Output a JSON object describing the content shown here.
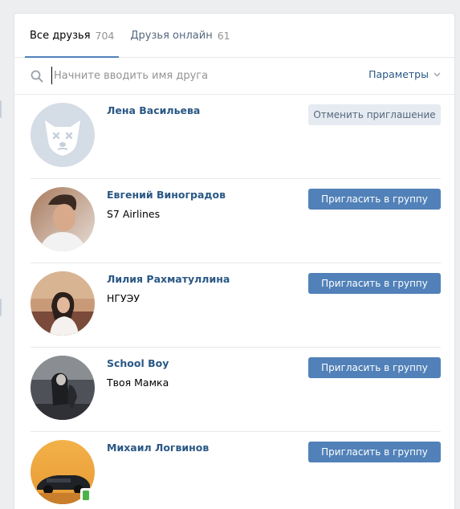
{
  "tabs": [
    {
      "label": "Все друзья",
      "count": "704",
      "active": true
    },
    {
      "label": "Друзья онлайн",
      "count": "61",
      "active": false
    }
  ],
  "search": {
    "placeholder": "Начните вводить имя друга",
    "value": ""
  },
  "params_label": "Параметры",
  "friends": [
    {
      "name": "Лена Васильева",
      "subtitle": "",
      "action": "Отменить приглашение",
      "avatar": "deactivated-dog",
      "online_mobile": false
    },
    {
      "name": "Евгений Виноградов",
      "subtitle": "S7 Airlines",
      "action": "Пригласить в группу",
      "avatar": "photo",
      "online_mobile": false
    },
    {
      "name": "Лилия Рахматуллина",
      "subtitle": "НГУЭУ",
      "action": "Пригласить в группу",
      "avatar": "photo",
      "online_mobile": false
    },
    {
      "name": "School Boy",
      "subtitle": "Твоя Мамка",
      "action": "Пригласить в группу",
      "avatar": "photo",
      "online_mobile": false
    },
    {
      "name": "Михаил Логвинов",
      "subtitle": "",
      "action": "Пригласить в группу",
      "avatar": "photo",
      "online_mobile": true
    }
  ],
  "colors": {
    "accent": "#5181b8",
    "link": "#2a5885",
    "secondary_button": "#e5ebf1",
    "background": "#edeef0",
    "online_mobile": "#4bb34b"
  }
}
